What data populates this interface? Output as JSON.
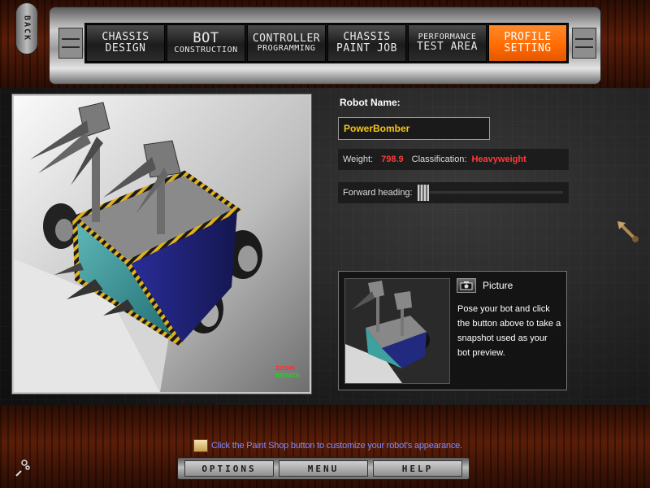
{
  "nav": {
    "back_label": "BACK",
    "tabs": [
      {
        "line1": "CHASSIS",
        "line2": "DESIGN",
        "active": false
      },
      {
        "line1": "BOT",
        "line2": "CONSTRUCTION",
        "active": false
      },
      {
        "line1": "CONTROLLER",
        "line2": "PROGRAMMING",
        "active": false
      },
      {
        "line1": "CHASSIS",
        "line2": "PAINT JOB",
        "active": false
      },
      {
        "line1": "PERFORMANCE",
        "line2": "TEST AREA",
        "active": false
      },
      {
        "line1": "PROFILE",
        "line2": "SETTING",
        "active": true
      }
    ]
  },
  "viewport": {
    "zoom_label": "ZOOM",
    "rotate_label": "ROTATE"
  },
  "profile": {
    "robot_name_label": "Robot Name:",
    "robot_name_value": "PowerBomber",
    "weight_label": "Weight:",
    "weight_value": "798.9",
    "classification_label": "Classification:",
    "classification_value": "Heavyweight",
    "heading_label": "Forward heading:",
    "heading_value": 0
  },
  "picture": {
    "title": "Picture",
    "description": "Pose your bot and click the button above to take a snapshot used as your bot preview."
  },
  "footer": {
    "tip": "Click the Paint Shop button to customize your robot's appearance.",
    "buttons": [
      "OPTIONS",
      "MENU",
      "HELP"
    ]
  },
  "colors": {
    "accent_orange": "#ff6a00",
    "name_yellow": "#f5c518",
    "stat_red": "#ff3a3a",
    "tip_blue": "#7f8cff"
  }
}
